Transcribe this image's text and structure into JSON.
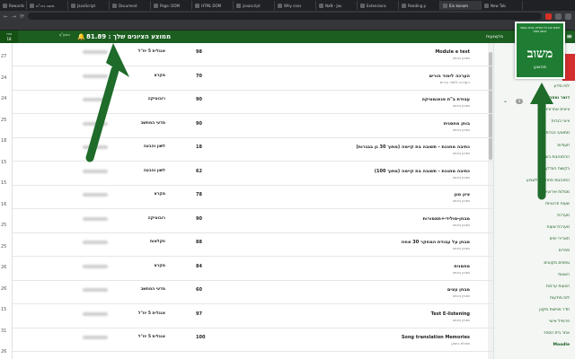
{
  "browser": {
    "tabs": [
      {
        "label": "Rewards",
        "active": false
      },
      {
        "label": "משוב ביה\"ס",
        "active": false
      },
      {
        "label": "JavaScript",
        "active": false
      },
      {
        "label": "Document",
        "active": false
      },
      {
        "label": "Page: DOM",
        "active": false
      },
      {
        "label": "HTML DOM",
        "active": false
      },
      {
        "label": "javascript",
        "active": false
      },
      {
        "label": "Why cons",
        "active": false
      },
      {
        "label": "NaN - Jav",
        "active": false
      },
      {
        "label": "Extensions",
        "active": false
      },
      {
        "label": "Reading p",
        "active": false
      },
      {
        "label": "Ein konom",
        "active": true
      },
      {
        "label": "New Tab",
        "active": false
      }
    ],
    "url": ""
  },
  "header": {
    "left_user_lines": [
      "ביה",
      "18"
    ],
    "username_lines": [
      "",
      "תשע\"ף"
    ],
    "average_text": "ממוצע הציונים שלך : 81.89",
    "app_title": "מקצועות"
  },
  "left_numbers": [
    "27",
    "24",
    "24",
    "25",
    "18",
    "15",
    "15",
    "16",
    "25",
    "25",
    "26",
    "26",
    "15",
    "31",
    "26"
  ],
  "rows": [
    {
      "score": "98",
      "category": "אנגלית 5 יח\"ל",
      "title": "Module e test",
      "sub": "מבחן בכתב"
    },
    {
      "score": "70",
      "category": "מקרא",
      "title": "הערכה לימוד הורים",
      "sub": "הערכה לימוד הורים"
    },
    {
      "score": "90",
      "category": "רובוטיקה",
      "title": "עבודת ב\"ת פנאומטיקה",
      "sub": "מבחן בכתב"
    },
    {
      "score": "90",
      "category": "מדעי המחשב",
      "title": "בוחן מחסנית",
      "sub": "מבחן בכתב"
    },
    {
      "score": "18",
      "category": "לשון והבעה",
      "title": "כתיבה מחנכת - תשובה בת קיימה (מתוך 30 גן בבגרות)",
      "sub": "מבחן בכתב"
    },
    {
      "score": "62",
      "category": "לשון והבעה",
      "title": "כתיבה מחנכת - תשובה בת קיימה (מתוך 100)",
      "sub": "מבחן בכתב"
    },
    {
      "score": "78",
      "category": "מקרא",
      "title": "ציון מגן",
      "sub": "מבחן בכתב"
    },
    {
      "score": "90",
      "category": "רובוטיקה",
      "title": "מבחן-סולידי+תמסורות",
      "sub": "מבחן בכתב"
    },
    {
      "score": "88",
      "category": "חקלאות",
      "title": "מבחן על עבודת המחקר 30 אחוז",
      "sub": "מבחן בכתב"
    },
    {
      "score": "84",
      "category": "מקרא",
      "title": "מחסנית",
      "sub": "מבחן בכתב"
    },
    {
      "score": "60",
      "category": "מדעי המחשב",
      "title": "מבחן עצים",
      "sub": "מבחן בכתב"
    },
    {
      "score": "97",
      "category": "אנגלית 5 יח\"ל",
      "title": "Test E-listening",
      "sub": "מבחן בכתב"
    },
    {
      "score": "100",
      "category": "אנגלית 5 יח\"ל",
      "title": "Song translation Memories",
      "sub": "מטלת ביצוע"
    }
  ],
  "sidebar": {
    "badge": "4",
    "items": [
      {
        "label": "לוח מידע",
        "bold": false
      },
      {
        "label": "דואר ומסרונים",
        "bold": true
      },
      {
        "label": "ציונים אחרונים",
        "bold": false
      },
      {
        "label": "ציוני בגרות",
        "bold": false
      },
      {
        "label": "ממוצעי בגרות",
        "bold": false
      },
      {
        "label": "תעודות",
        "bold": false
      },
      {
        "label": "ההתנהגות בשיעור",
        "bold": false
      },
      {
        "label": "בקשות הצדקה",
        "bold": false
      },
      {
        "label": "התנהגות מתוקנים לשבוע",
        "bold": false
      },
      {
        "label": "מטלות אירועים",
        "bold": false
      },
      {
        "label": "שעות פרטניות",
        "bold": false
      },
      {
        "label": "מערכת",
        "bold": false
      },
      {
        "label": "מערכת שעות",
        "bold": false
      },
      {
        "label": "תאריכי ימים",
        "bold": false
      },
      {
        "label": "ספרים",
        "bold": false
      },
      {
        "label": "טפסים מקוונים",
        "bold": false
      },
      {
        "label": "האצות",
        "bold": false
      },
      {
        "label": "הצעות ערבות",
        "bold": false
      },
      {
        "label": "לוח מודעות",
        "bold": false
      },
      {
        "label": "חדר פגישות מקוון",
        "bold": false
      },
      {
        "label": "פרופיל אישי",
        "bold": false
      },
      {
        "label": "אתר בית הספר",
        "bold": false
      },
      {
        "label": "Moodle",
        "bold": true
      }
    ]
  },
  "logo": {
    "tagline": "רוצים את כל המידע בבית הספר ובזמן אמת",
    "name": "משוב",
    "sub": "מהוצע"
  },
  "colors": {
    "primary_green": "#1b5e20",
    "sidebar_bg": "#f3f6f3",
    "arrow_green": "#1e6b2a"
  }
}
